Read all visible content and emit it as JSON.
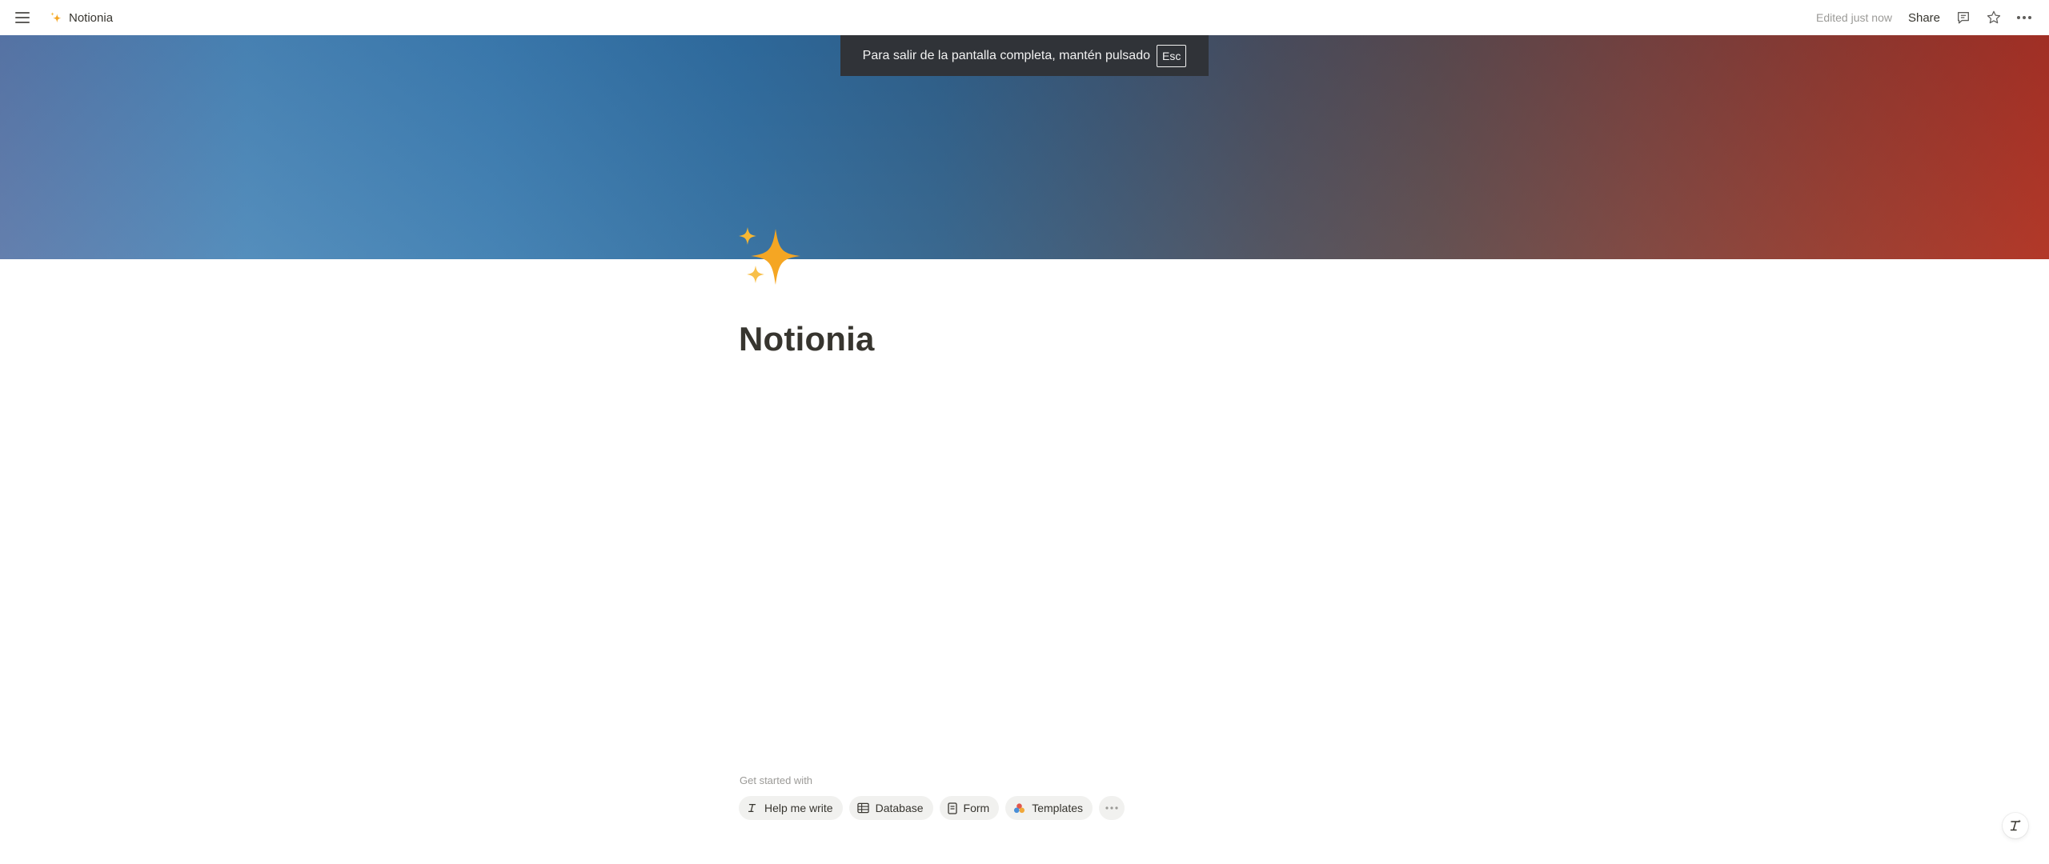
{
  "topbar": {
    "page_name": "Notionia",
    "edited_status": "Edited just now",
    "share_label": "Share"
  },
  "fullscreen_notice": {
    "text": "Para salir de la pantalla completa, mantén pulsado",
    "key": "Esc"
  },
  "page": {
    "icon": "sparkles-icon",
    "title": "Notionia"
  },
  "get_started": {
    "label": "Get started with",
    "chips": [
      {
        "label": "Help me write",
        "icon": "ai-pen-icon"
      },
      {
        "label": "Database",
        "icon": "table-icon"
      },
      {
        "label": "Form",
        "icon": "form-icon"
      },
      {
        "label": "Templates",
        "icon": "templates-icon"
      }
    ]
  },
  "colors": {
    "cover_left": "#5a77a8",
    "cover_middle": "#2e6c9e",
    "cover_right": "#ae2c1b",
    "sparkle": "#f5a623",
    "text": "#37352f",
    "muted": "#9b9a97"
  }
}
